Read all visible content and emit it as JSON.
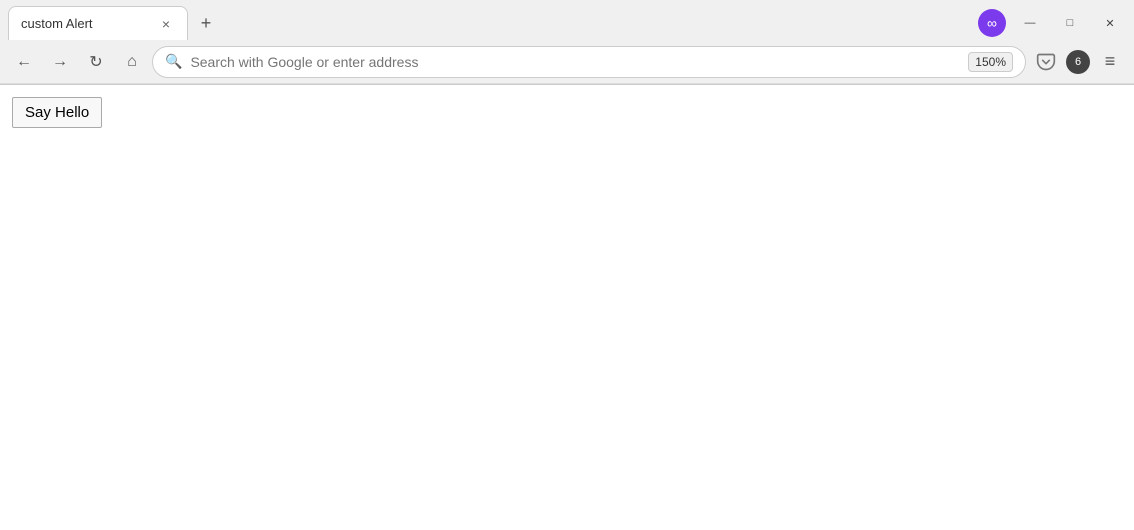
{
  "browser": {
    "tab": {
      "title": "custom Alert",
      "close_label": "×"
    },
    "new_tab_label": "+",
    "logo_symbol": "∞",
    "window_controls": {
      "minimize": "—",
      "maximize": "□",
      "close": "✕"
    }
  },
  "navbar": {
    "back_label": "←",
    "forward_label": "→",
    "reload_label": "↻",
    "home_label": "⌂",
    "search_placeholder": "Search with Google or enter address",
    "zoom_level": "150%",
    "pocket_label": "☆",
    "notifications_count": "6",
    "menu_label": "≡"
  },
  "page": {
    "say_hello_label": "Say Hello"
  }
}
